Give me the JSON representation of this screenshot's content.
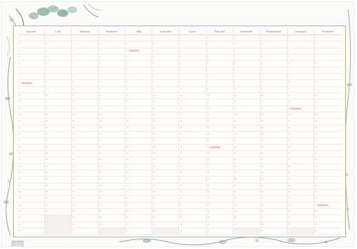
{
  "planner": {
    "months": [
      "Styczeń",
      "Luty",
      "Marzec",
      "Kwiecień",
      "Maj",
      "Czerwiec",
      "Lipiec",
      "Sierpień",
      "Wrzesień",
      "Październik",
      "Listopad",
      "Grudzień"
    ],
    "days_in_month": [
      31,
      28,
      31,
      30,
      31,
      30,
      31,
      31,
      30,
      31,
      30,
      31
    ],
    "rows": 31
  },
  "footer": {
    "logo_text": "",
    "mark_text": ""
  },
  "colors": {
    "frame_border": "#e8a75e",
    "note_highlight": "#f2b8b4",
    "leaf_green": "#7fa892",
    "leaf_navy": "#3f4a78",
    "leaf_mauve": "#b58aa0",
    "leaf_peach": "#e8b58e"
  },
  "highlights": [
    {
      "month": 0,
      "day": 8
    },
    {
      "month": 4,
      "day": 3
    },
    {
      "month": 7,
      "day": 18
    },
    {
      "month": 10,
      "day": 12
    },
    {
      "month": 11,
      "day": 27
    }
  ]
}
